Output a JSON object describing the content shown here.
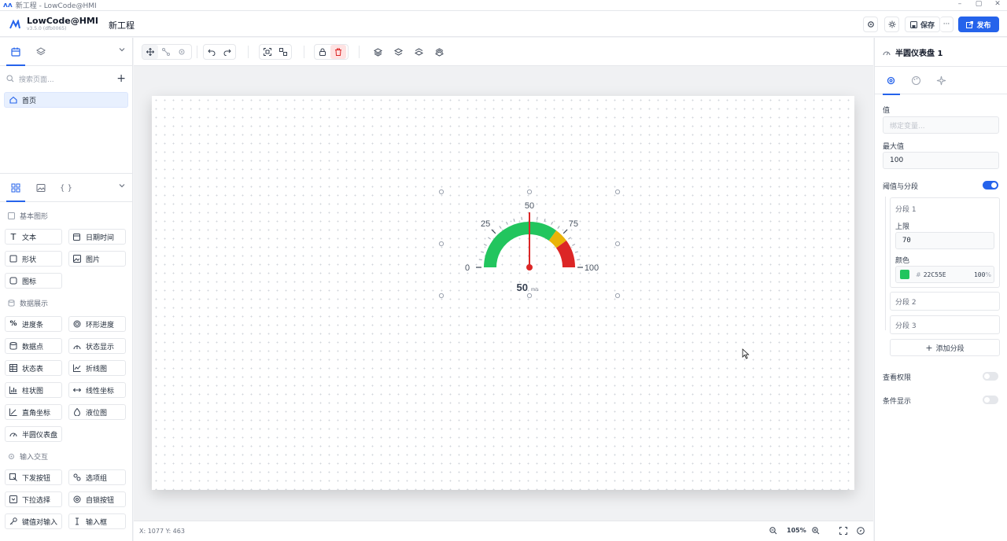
{
  "window": {
    "title": "新工程 - LowCode@HMI",
    "controls": [
      "–",
      "▢",
      "✕"
    ]
  },
  "header": {
    "app_name": "LowCode@HMI",
    "version": "v3.5.0 (dfb0065)",
    "project_name": "新工程",
    "save_label": "保存",
    "more_label": "···",
    "publish_label": "发布",
    "icons": [
      "settings-icon",
      "theme-icon",
      "save-icon",
      "publish-icon"
    ]
  },
  "left": {
    "search_placeholder": "搜索页面...",
    "add_label": "+",
    "pages": [
      {
        "label": "首页"
      }
    ],
    "sections": [
      {
        "title": "基本图形",
        "items": [
          "文本",
          "日期时间",
          "形状",
          "图片",
          "图标"
        ]
      },
      {
        "title": "数据展示",
        "items": [
          "进度条",
          "环形进度",
          "数据点",
          "状态显示",
          "状态表",
          "折线图",
          "柱状图",
          "线性坐标",
          "直角坐标",
          "液位图",
          "半圆仪表盘"
        ]
      },
      {
        "title": "输入交互",
        "items": [
          "下发按钮",
          "选项组",
          "下拉选择",
          "自锁按钮",
          "键值对输入",
          "输入框"
        ]
      }
    ]
  },
  "gauge": {
    "min": 0,
    "max": 100,
    "ticks": [
      "0",
      "25",
      "50",
      "75",
      "100"
    ],
    "value": 50,
    "value_label": "50",
    "unit": "m/s",
    "segments": [
      {
        "upper": 70,
        "color": "#22C55E"
      },
      {
        "upper": 80,
        "color": "#EAB308"
      },
      {
        "upper": 100,
        "color": "#DC2626"
      }
    ],
    "needle_color": "#DC2626"
  },
  "status": {
    "coords": "X: 1077 Y: 463",
    "zoom": "105%"
  },
  "right": {
    "title": "半圆仪表盘 1",
    "value_label": "值",
    "value_placeholder": "绑定变量...",
    "max_label": "最大值",
    "max_value": "100",
    "threshold_label": "阈值与分段",
    "threshold_on": true,
    "segment1_title": "分段 1",
    "upper_label": "上限",
    "upper_value": "70",
    "color_label": "颜色",
    "color_hash": "#",
    "color_value": "22C55E",
    "color_hex": "#22C55E",
    "opacity_value": "100",
    "opacity_unit": "%",
    "segment2_title": "分段 2",
    "segment3_title": "分段 3",
    "add_segment_label": "添加分段",
    "view_perm_label": "查看权限",
    "view_perm_on": false,
    "cond_display_label": "条件显示",
    "cond_display_on": false
  }
}
